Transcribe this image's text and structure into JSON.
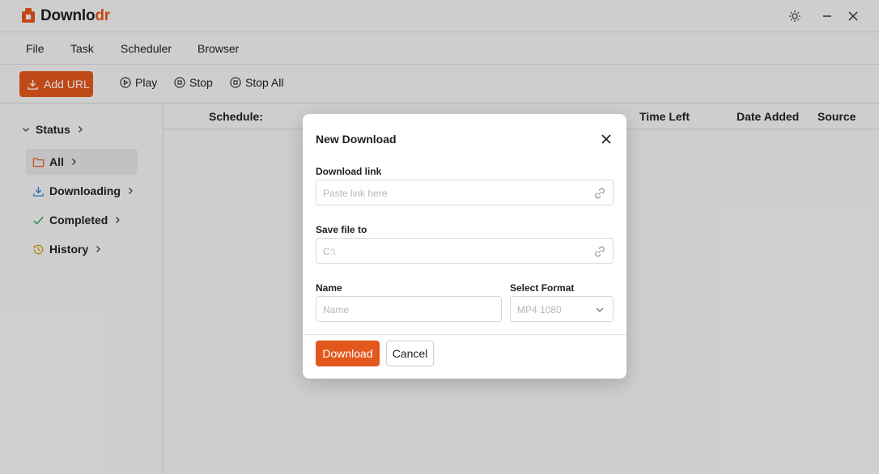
{
  "app": {
    "brand_prefix": "Downlo",
    "brand_suffix": "dr",
    "accent_color": "#e2571c"
  },
  "menu": [
    "File",
    "Task",
    "Scheduler",
    "Browser"
  ],
  "toolbar": {
    "add_url": "Add URL",
    "play": "Play",
    "stop": "Stop",
    "stop_all": "Stop All"
  },
  "sidebar": {
    "status": "Status",
    "items": [
      "All",
      "Downloading",
      "Completed",
      "History"
    ]
  },
  "table": {
    "columns": [
      "Schedule:",
      "Time Left",
      "Date Added",
      "Source"
    ]
  },
  "modal": {
    "title": "New Download",
    "link_label": "Download link",
    "link_placeholder": "Paste link here",
    "save_label": "Save file to",
    "save_placeholder": "C:\\",
    "name_label": "Name",
    "name_placeholder": "Name",
    "format_label": "Select Format",
    "format_value": "MP4 1080",
    "download_btn": "Download",
    "cancel_btn": "Cancel"
  }
}
